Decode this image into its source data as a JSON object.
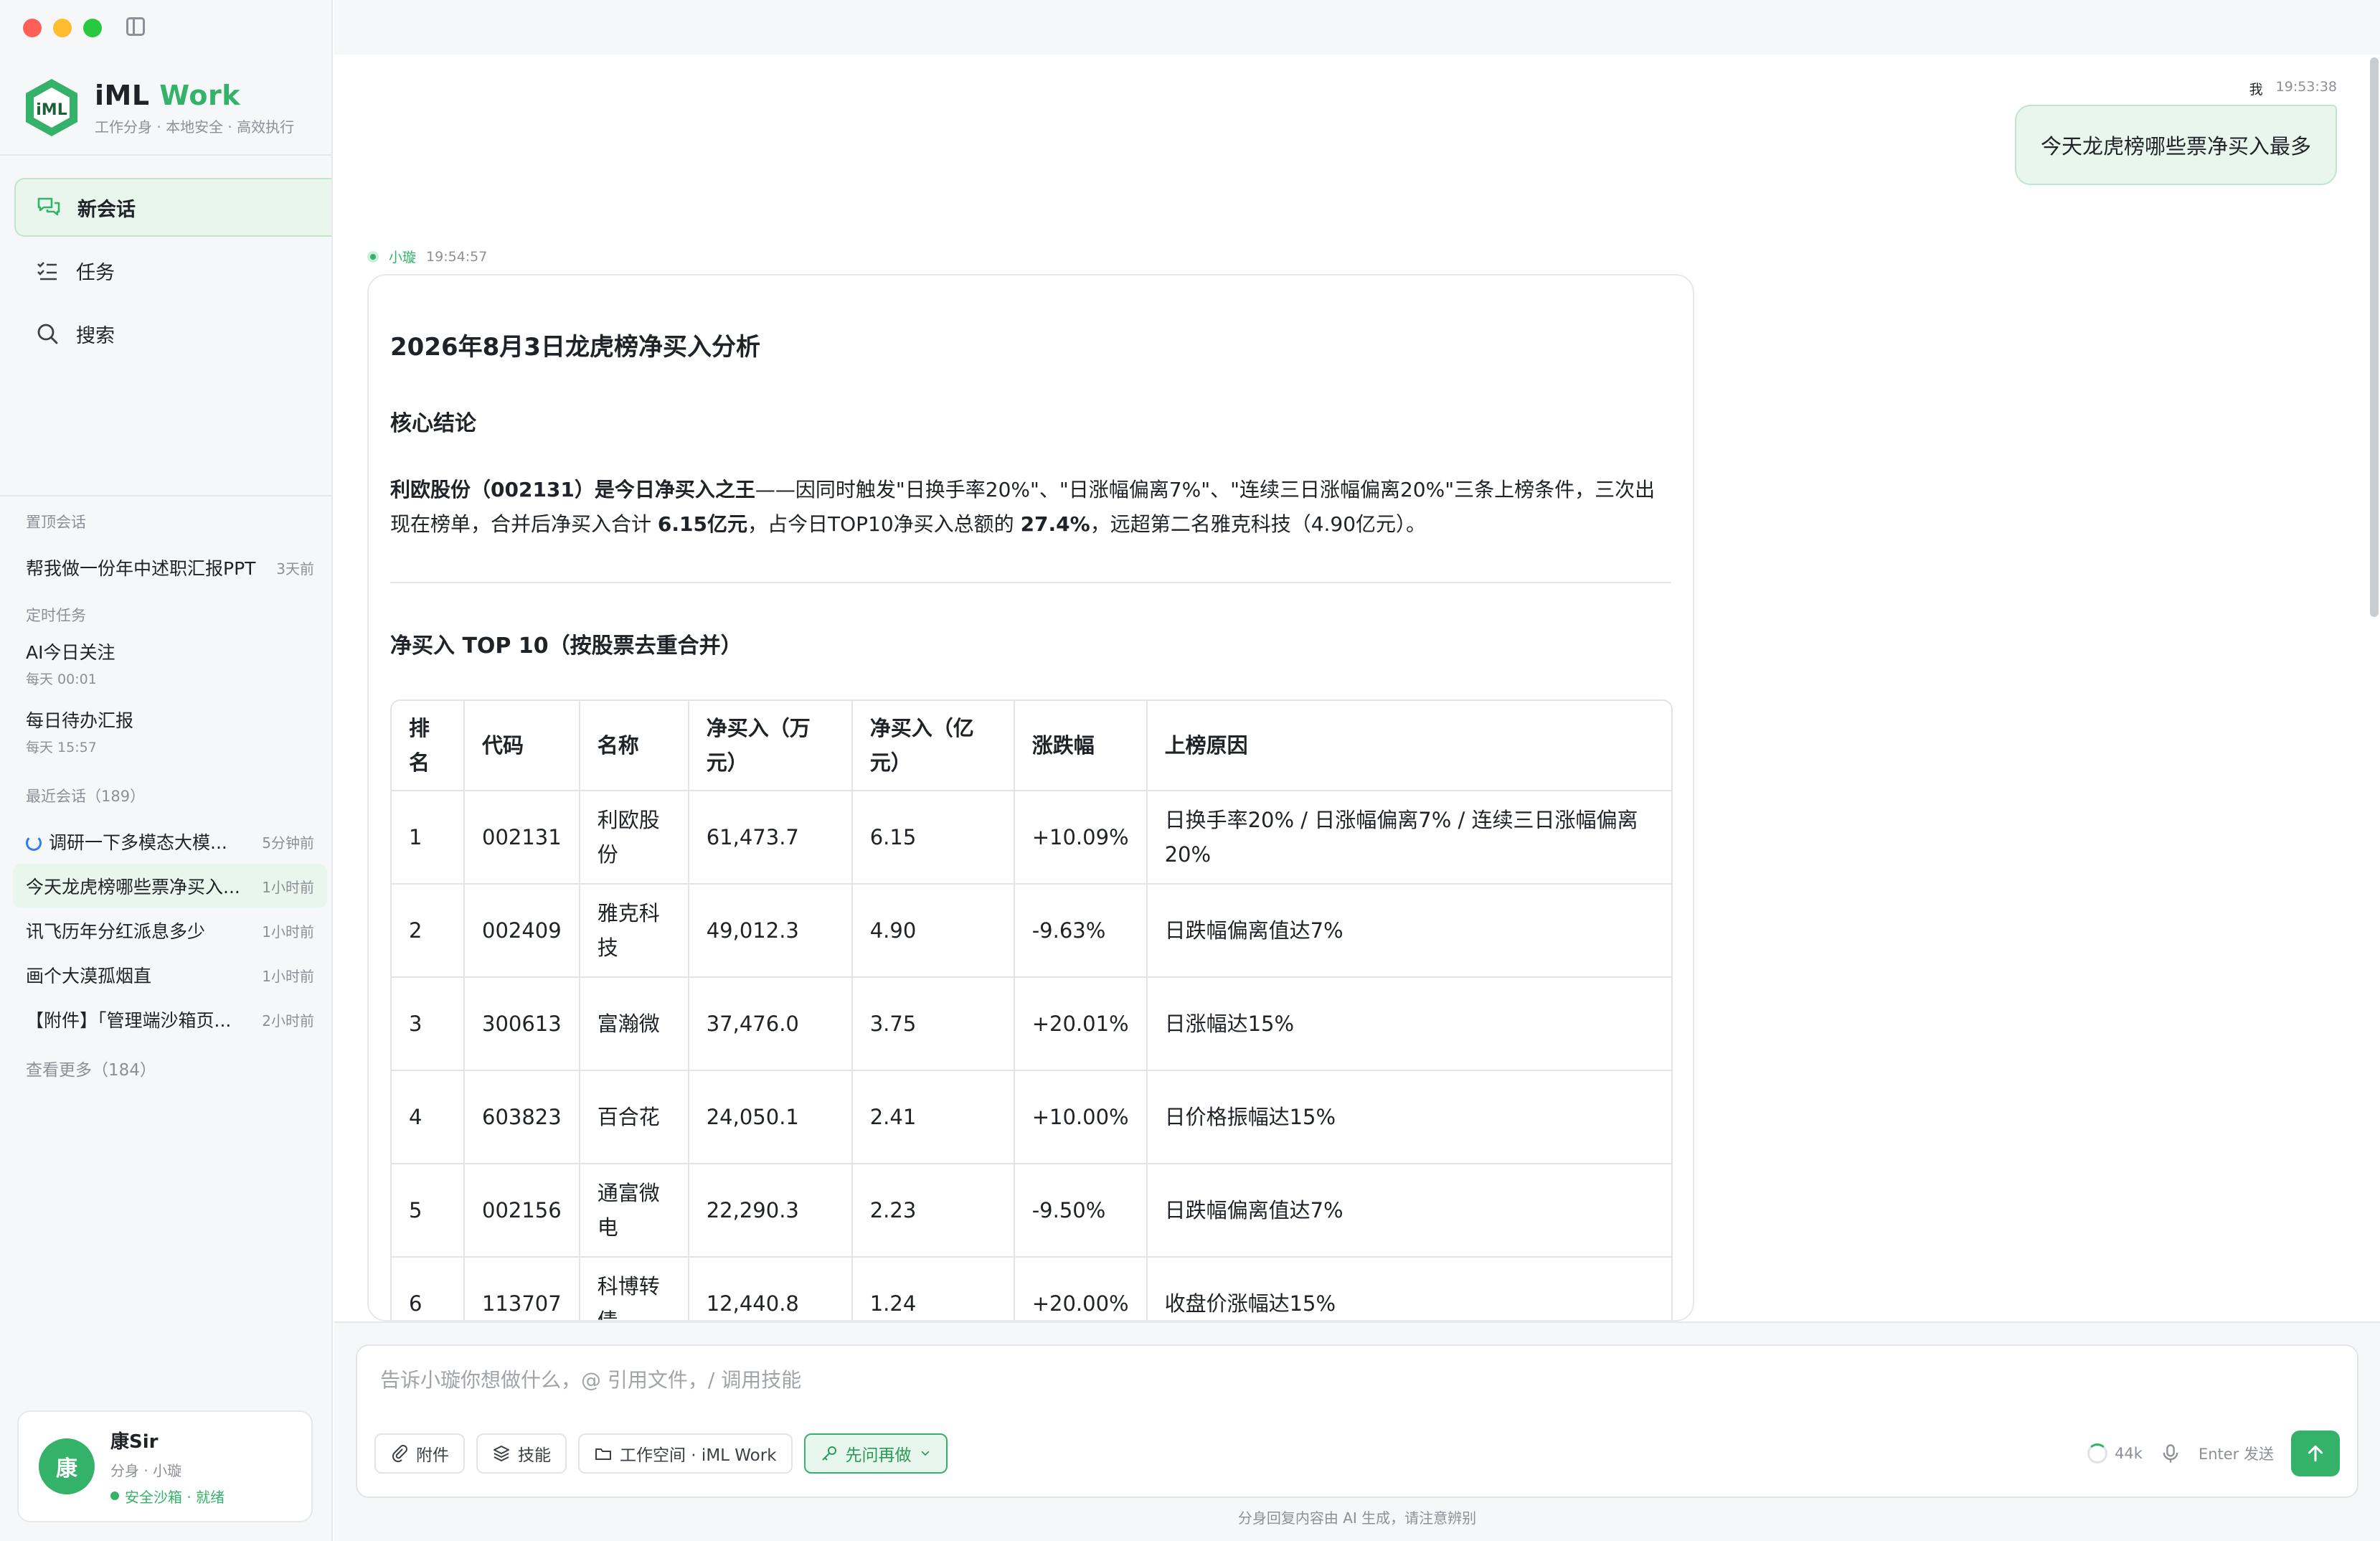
{
  "sidebar": {
    "brand": {
      "name_prefix": "iML",
      "name_accent": "Work",
      "tagline": "工作分身 · 本地安全 · 高效执行"
    },
    "nav": [
      {
        "label": "新会话",
        "icon": "chat-icon",
        "active": true
      },
      {
        "label": "任务",
        "icon": "task-list-icon"
      },
      {
        "label": "搜索",
        "icon": "search-icon"
      }
    ],
    "pinned": {
      "title": "置顶会话",
      "items": [
        {
          "label": "帮我做一份年中述职汇报PPT",
          "time": "3天前"
        }
      ]
    },
    "scheduled": {
      "title": "定时任务",
      "items": [
        {
          "label": "AI今日关注",
          "schedule": "每天 00:01"
        },
        {
          "label": "每日待办汇报",
          "schedule": "每天 15:57"
        }
      ]
    },
    "recent": {
      "title": "最近会话（189）",
      "items": [
        {
          "label": "调研一下多模态大模...",
          "time": "5分钟前",
          "loading": true
        },
        {
          "label": "今天龙虎榜哪些票净买入...",
          "time": "1小时前",
          "active": true
        },
        {
          "label": "讯飞历年分红派息多少",
          "time": "1小时前"
        },
        {
          "label": "画个大漠孤烟直",
          "time": "1小时前"
        },
        {
          "label": "【附件】「管理端沙箱页...",
          "time": "2小时前"
        }
      ],
      "see_more": "查看更多（184）"
    },
    "user": {
      "avatar": "康",
      "name": "康Sir",
      "role": "分身 · 小璇",
      "status": "安全沙箱 · 就绪"
    }
  },
  "chat": {
    "user_message": {
      "sender": "我",
      "time": "19:53:38",
      "text": "今天龙虎榜哪些票净买入最多"
    },
    "ai_message": {
      "sender": "小璇",
      "time": "19:54:57",
      "title": "2026年8月3日龙虎榜净买入分析",
      "section1": "核心结论",
      "p_bold1": "利欧股份（002131）是今日净买入之王",
      "p_text1": "——因同时触发\"日换手率20%\"、\"日涨幅偏离7%\"、\"连续三日涨幅偏离20%\"三条上榜条件，三次出现在榜单，合并后净买入合计 ",
      "p_bold2": "6.15亿元",
      "p_text2": "，占今日TOP10净买入总额的 ",
      "p_bold3": "27.4%",
      "p_text3": "，远超第二名雅克科技（4.90亿元）。",
      "section2": "净买入 TOP 10（按股票去重合并）",
      "table": {
        "headers": [
          "排名",
          "代码",
          "名称",
          "净买入（万元）",
          "净买入（亿元）",
          "涨跌幅",
          "上榜原因"
        ],
        "rows": [
          [
            "1",
            "002131",
            "利欧股份",
            "61,473.7",
            "6.15",
            "+10.09%",
            "日换手率20% / 日涨幅偏离7% / 连续三日涨幅偏离20%"
          ],
          [
            "2",
            "002409",
            "雅克科技",
            "49,012.3",
            "4.90",
            "-9.63%",
            "日跌幅偏离值达7%"
          ],
          [
            "3",
            "300613",
            "富瀚微",
            "37,476.0",
            "3.75",
            "+20.01%",
            "日涨幅达15%"
          ],
          [
            "4",
            "603823",
            "百合花",
            "24,050.1",
            "2.41",
            "+10.00%",
            "日价格振幅达15%"
          ],
          [
            "5",
            "002156",
            "通富微电",
            "22,290.3",
            "2.23",
            "-9.50%",
            "日跌幅偏离值达7%"
          ],
          [
            "6",
            "113707",
            "科博转债",
            "12,440.8",
            "1.24",
            "+20.00%",
            "收盘价涨幅达15%"
          ]
        ]
      }
    }
  },
  "composer": {
    "placeholder": "告诉小璇你想做什么，@ 引用文件，/ 调用技能",
    "tools": [
      {
        "label": "附件",
        "icon": "paperclip-icon"
      },
      {
        "label": "技能",
        "icon": "layers-icon"
      },
      {
        "label": "工作空间 · iML Work",
        "icon": "folder-icon"
      },
      {
        "label": "先问再做",
        "icon": "key-icon"
      }
    ],
    "context": "44k",
    "send_hint": "Enter 发送",
    "footer": "分身回复内容由 AI 生成，请注意辨别"
  },
  "colors": {
    "accent": "#34b26a",
    "accent_bg": "#e8f6ee",
    "border": "#e6e8eb"
  }
}
